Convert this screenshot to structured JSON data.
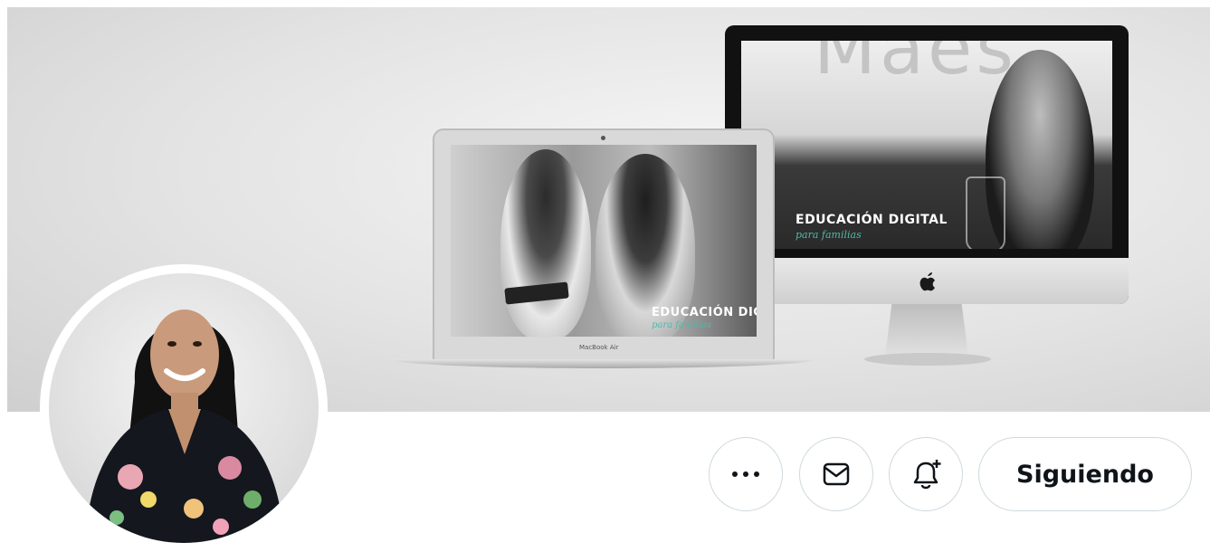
{
  "banner": {
    "imac_screen_title": "EDUCACIÓN DIGITAL",
    "imac_screen_subtitle": "para familias",
    "imac_top_text": "Maes",
    "laptop_screen_title": "EDUCACIÓN DIGITAL",
    "laptop_screen_subtitle": "para familias",
    "laptop_label": "MacBook Air"
  },
  "actions": {
    "more_icon": "more-horizontal-icon",
    "message_icon": "envelope-icon",
    "notify_icon": "bell-plus-icon",
    "follow_label": "Siguiendo"
  },
  "colors": {
    "accent_teal": "#4fb9aa",
    "button_border": "#cfd9de",
    "text_primary": "#0f1419"
  }
}
